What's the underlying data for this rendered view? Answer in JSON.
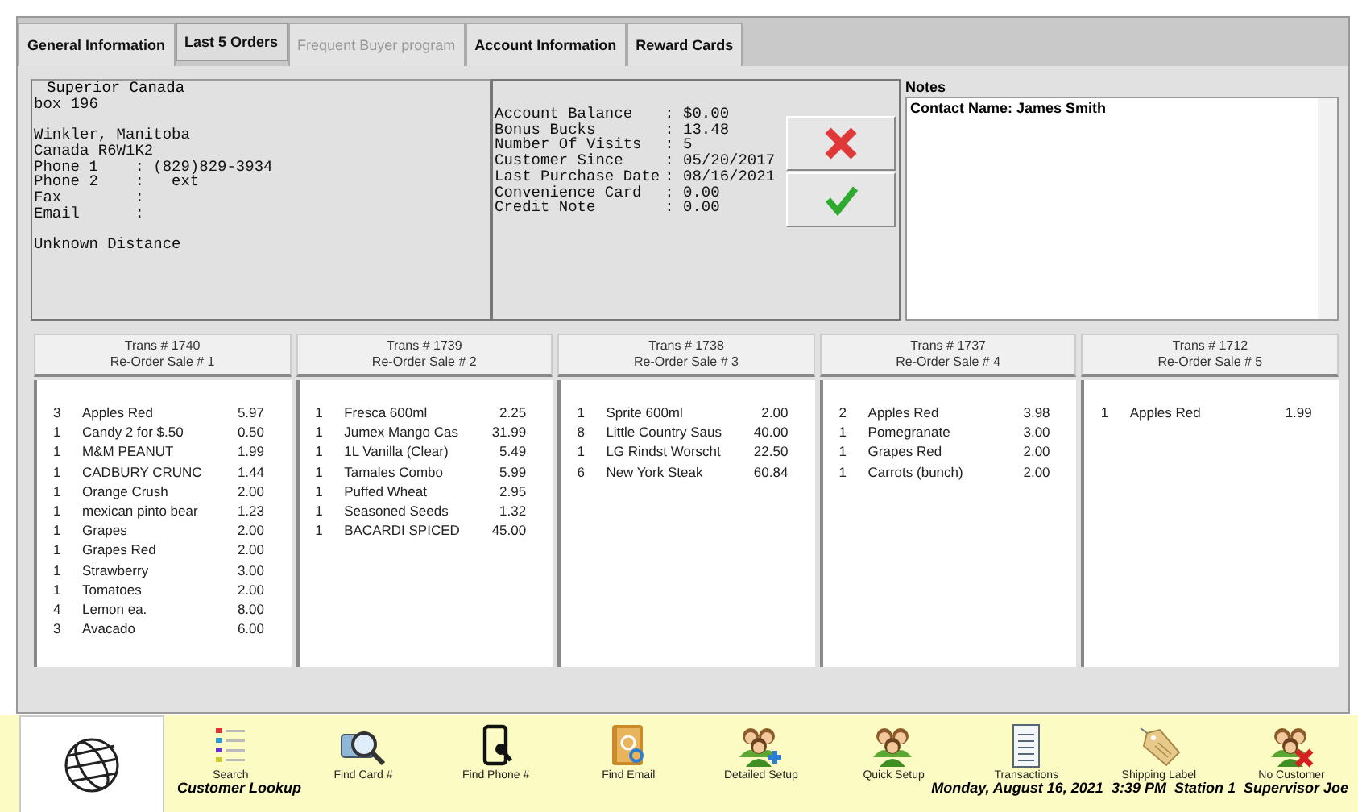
{
  "tabs": [
    {
      "label": "General Information",
      "selected": false,
      "disabled": false
    },
    {
      "label": "Last 5 Orders",
      "selected": true,
      "disabled": false
    },
    {
      "label": "Frequent Buyer program",
      "selected": false,
      "disabled": true
    },
    {
      "label": "Account Information",
      "selected": false,
      "disabled": false
    },
    {
      "label": "Reward Cards",
      "selected": false,
      "disabled": false
    }
  ],
  "customer": {
    "name": "Superior Canada",
    "blocks": [
      [
        "box 196"
      ],
      [
        "Winkler, Manitoba",
        "Canada R6W1K2",
        "Phone 1    : (829)829-3934",
        "Phone 2    :   ext",
        "Fax        :",
        "Email      :"
      ],
      [
        "Unknown Distance"
      ]
    ]
  },
  "account": [
    {
      "label": "Account Balance",
      "value": ": $0.00"
    },
    {
      "label": "Bonus Bucks",
      "value": ": 13.48"
    },
    {
      "label": "Number Of Visits",
      "value": ": 5"
    },
    {
      "label": "Customer Since",
      "value": ": 05/20/2017"
    },
    {
      "label": "Last Purchase Date",
      "value": ": 08/16/2021"
    },
    {
      "label": "Convenience Card",
      "value": ": 0.00"
    },
    {
      "label": "Credit Note",
      "value": ": 0.00"
    }
  ],
  "notes": {
    "label": "Notes",
    "value": "Contact Name: James Smith"
  },
  "orders": [
    {
      "trans": "Trans # 1740",
      "sale": "Re-Order Sale # 1",
      "items": [
        {
          "qty": "3",
          "name": "Apples Red",
          "price": "5.97"
        },
        {
          "qty": "1",
          "name": "Candy 2 for $.50",
          "price": "0.50"
        },
        {
          "qty": "1",
          "name": "M&M PEANUT",
          "price": "1.99"
        },
        {
          "qty": "1",
          "name": "CADBURY CRUNC",
          "price": "1.44"
        },
        {
          "qty": "1",
          "name": "Orange Crush",
          "price": "2.00"
        },
        {
          "qty": "1",
          "name": "mexican pinto bear",
          "price": "1.23"
        },
        {
          "qty": "1",
          "name": "Grapes",
          "price": "2.00"
        },
        {
          "qty": "1",
          "name": "Grapes Red",
          "price": "2.00"
        },
        {
          "qty": "1",
          "name": "Strawberry",
          "price": "3.00"
        },
        {
          "qty": "1",
          "name": "Tomatoes",
          "price": "2.00"
        },
        {
          "qty": "4",
          "name": "Lemon ea.",
          "price": "8.00"
        },
        {
          "qty": "3",
          "name": "Avacado",
          "price": "6.00"
        }
      ]
    },
    {
      "trans": "Trans # 1739",
      "sale": "Re-Order Sale # 2",
      "items": [
        {
          "qty": "1",
          "name": "Fresca 600ml",
          "price": "2.25"
        },
        {
          "qty": "1",
          "name": "Jumex Mango Cas",
          "price": "31.99"
        },
        {
          "qty": "1",
          "name": "1L Vanilla (Clear)",
          "price": "5.49"
        },
        {
          "qty": "1",
          "name": "Tamales Combo",
          "price": "5.99"
        },
        {
          "qty": "1",
          "name": "Puffed Wheat",
          "price": "2.95"
        },
        {
          "qty": "1",
          "name": "Seasoned Seeds",
          "price": "1.32"
        },
        {
          "qty": "1",
          "name": "BACARDI SPICED",
          "price": "45.00"
        }
      ]
    },
    {
      "trans": "Trans # 1738",
      "sale": "Re-Order Sale # 3",
      "items": [
        {
          "qty": "1",
          "name": "Sprite 600ml",
          "price": "2.00"
        },
        {
          "qty": "8",
          "name": "Little Country Saus",
          "price": "40.00"
        },
        {
          "qty": "1",
          "name": "LG Rindst Worscht",
          "price": "22.50"
        },
        {
          "qty": "6",
          "name": "New York Steak",
          "price": "60.84"
        }
      ]
    },
    {
      "trans": "Trans # 1737",
      "sale": "Re-Order Sale # 4",
      "items": [
        {
          "qty": "2",
          "name": "Apples Red",
          "price": "3.98"
        },
        {
          "qty": "1",
          "name": "Pomegranate",
          "price": "3.00"
        },
        {
          "qty": "1",
          "name": "Grapes Red",
          "price": "2.00"
        },
        {
          "qty": "1",
          "name": "Carrots (bunch)",
          "price": "2.00"
        }
      ]
    },
    {
      "trans": "Trans # 1712",
      "sale": "Re-Order Sale # 5",
      "items": [
        {
          "qty": "1",
          "name": "Apples Red",
          "price": "1.99"
        }
      ]
    }
  ],
  "toolbar": [
    {
      "label": "Search",
      "kind": "list"
    },
    {
      "label": "Find Card #",
      "kind": "card"
    },
    {
      "label": "Find Phone #",
      "kind": "phone"
    },
    {
      "label": "Find Email",
      "kind": "email"
    },
    {
      "label": "Detailed Setup",
      "kind": "people-plus"
    },
    {
      "label": "Quick Setup",
      "kind": "people"
    },
    {
      "label": "Transactions",
      "kind": "document"
    },
    {
      "label": "Shipping Label",
      "kind": "tag"
    },
    {
      "label": "No Customer",
      "kind": "people-x"
    }
  ],
  "status_bar": {
    "mode": "Customer Lookup",
    "info": "Monday, August 16, 2021  3:39 PM  Station 1  Supervisor Joe"
  }
}
